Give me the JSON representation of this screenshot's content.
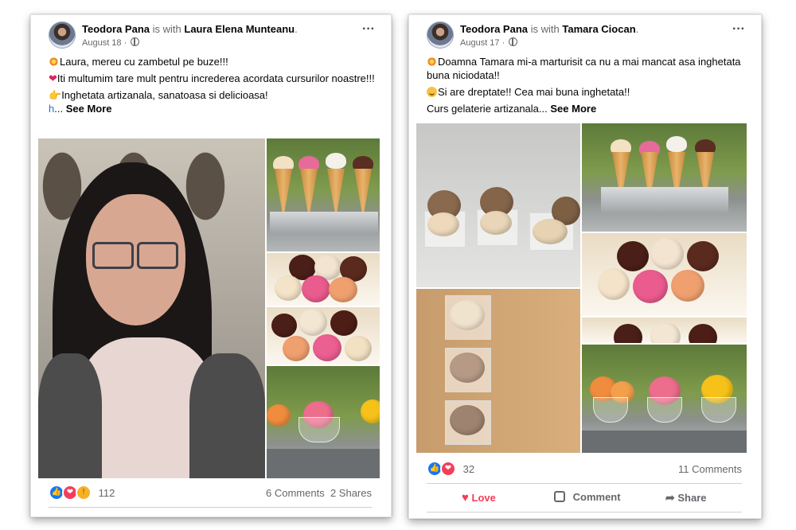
{
  "posts": [
    {
      "author": "Teodora Pana",
      "with_text": "is with",
      "tagged": "Laura Elena Munteanu",
      "date": "August 18",
      "lines": [
        "Laura, mereu cu zambetul pe buze!!!",
        "Iti multumim tare mult pentru increderea acordata cursurilor noastre!!!",
        "Inghetata artizanala, sanatoasa si delicioasa!"
      ],
      "link_fragment": "h",
      "ellipsis": "...",
      "see_more": "See More",
      "reaction_count": "112",
      "comments": "6 Comments",
      "shares": "2 Shares"
    },
    {
      "author": "Teodora Pana",
      "with_text": "is with",
      "tagged": "Tamara Ciocan",
      "date": "August 17",
      "lines": [
        "Doamna Tamara mi-a marturisit ca nu a mai mancat asa inghetata buna niciodata!!",
        "Si are dreptate!! Cea mai buna inghetata!!",
        "Curs gelaterie artizanala"
      ],
      "ellipsis": "...",
      "see_more": "See More",
      "reaction_count": "32",
      "comments": "11 Comments",
      "actions": {
        "love": "Love",
        "comment": "Comment",
        "share": "Share"
      }
    }
  ],
  "icons": {
    "reaction_like": "like-icon",
    "reaction_love": "love-icon",
    "reaction_wow": "wow-icon",
    "options": "more-options-icon",
    "privacy": "globe-icon"
  },
  "colors": {
    "name_text": "#050505",
    "secondary_text": "#65676b",
    "love": "#f33e58",
    "like": "#1877f2"
  }
}
